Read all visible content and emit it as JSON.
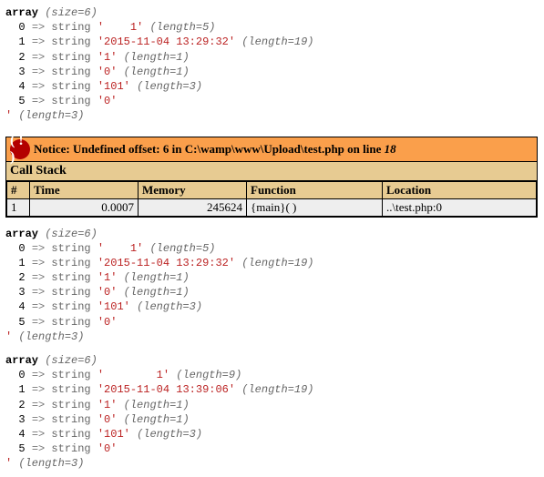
{
  "dump1": {
    "header_pre": "array ",
    "header_size": "(size=6)",
    "rows": [
      {
        "idx": "0",
        "val": "    1",
        "len": "5"
      },
      {
        "idx": "1",
        "val": "2015-11-04 13:29:32",
        "len": "19"
      },
      {
        "idx": "2",
        "val": "1",
        "len": "1"
      },
      {
        "idx": "3",
        "val": "0",
        "len": "1"
      },
      {
        "idx": "4",
        "val": "101",
        "len": "3"
      },
      {
        "idx": "5",
        "val": "0",
        "len": null
      }
    ],
    "tail_len": "3"
  },
  "notice": {
    "label": "Notice:",
    "msg_a": "Undefined offset: 6 in ",
    "msg_b": "C:\\wamp\\www\\Upload\\test.php",
    "msg_c": " on line ",
    "line": "18",
    "cs_title": "Call Stack",
    "cols": {
      "n": "#",
      "time": "Time",
      "mem": "Memory",
      "fn": "Function",
      "loc": "Location"
    },
    "row": {
      "n": "1",
      "time": "0.0007",
      "mem": "245624",
      "fn": "{main}( )",
      "loc": "..\\test.php:0"
    }
  },
  "dump2": {
    "header_pre": "array ",
    "header_size": "(size=6)",
    "rows": [
      {
        "idx": "0",
        "val": "    1",
        "len": "5"
      },
      {
        "idx": "1",
        "val": "2015-11-04 13:29:32",
        "len": "19"
      },
      {
        "idx": "2",
        "val": "1",
        "len": "1"
      },
      {
        "idx": "3",
        "val": "0",
        "len": "1"
      },
      {
        "idx": "4",
        "val": "101",
        "len": "3"
      },
      {
        "idx": "5",
        "val": "0",
        "len": null
      }
    ],
    "tail_len": "3"
  },
  "dump3": {
    "header_pre": "array ",
    "header_size": "(size=6)",
    "rows": [
      {
        "idx": "0",
        "val": "        1",
        "len": "9"
      },
      {
        "idx": "1",
        "val": "2015-11-04 13:39:06",
        "len": "19"
      },
      {
        "idx": "2",
        "val": "1",
        "len": "1"
      },
      {
        "idx": "3",
        "val": "0",
        "len": "1"
      },
      {
        "idx": "4",
        "val": "101",
        "len": "3"
      },
      {
        "idx": "5",
        "val": "0",
        "len": null
      }
    ],
    "tail_len": "3"
  }
}
